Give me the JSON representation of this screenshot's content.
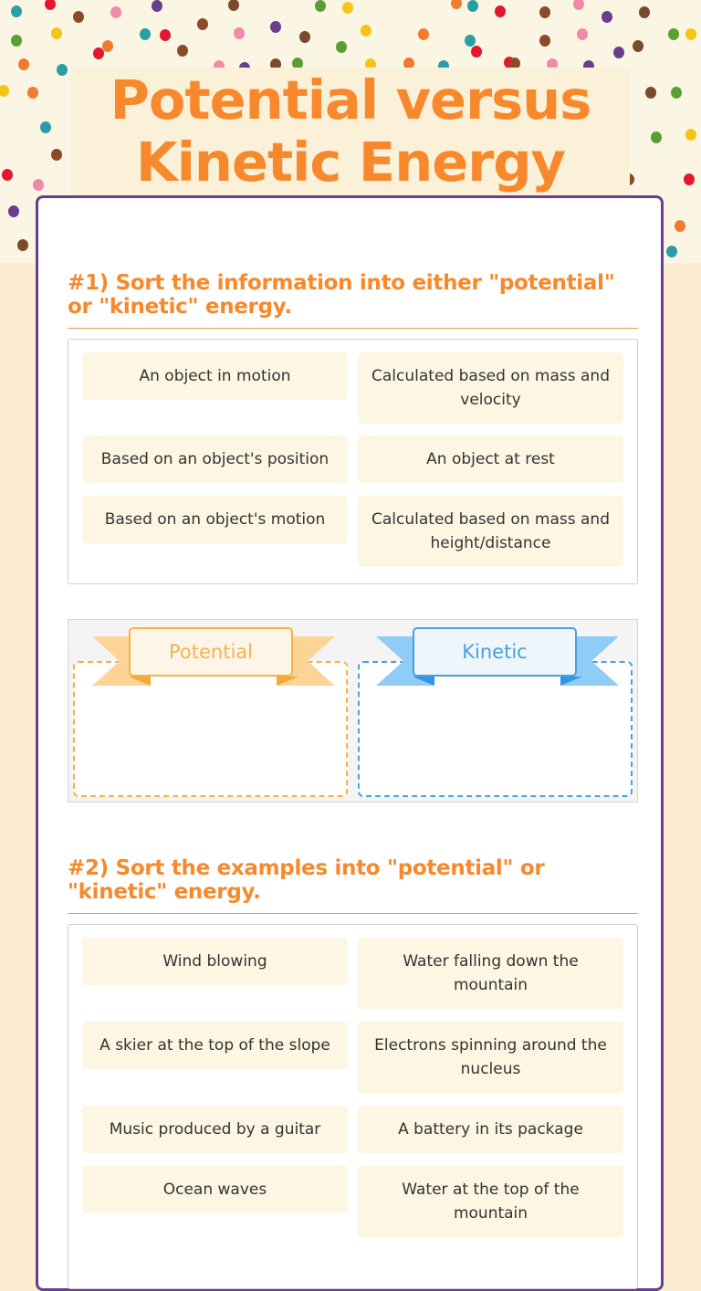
{
  "page": {
    "title_line1": "Potential versus",
    "title_line2": "Kinetic Energy"
  },
  "colors": {
    "accent_orange": "#f7892c",
    "card_border_purple": "#6a3d8f",
    "potential_color": "#f6b13f",
    "kinetic_color": "#4ba0df",
    "tile_bg": "#fdf6e3"
  },
  "section1": {
    "heading": "#1) Sort the information into either \"potential\" or \"kinetic\" energy.",
    "tiles": [
      "An object in motion",
      "Calculated based on mass and velocity",
      "Based on an object's position",
      "An object at rest",
      "Based on an object's motion",
      "Calculated based on mass and height/distance"
    ],
    "categories": [
      {
        "label": "Potential"
      },
      {
        "label": "Kinetic"
      }
    ]
  },
  "section2": {
    "heading": "#2) Sort the examples into \"potential\" or \"kinetic\" energy.",
    "tiles": [
      "Wind blowing",
      "Water falling down the mountain",
      "A skier at the top of the slope",
      "Electrons spinning around the nucleus",
      "Music produced by a guitar",
      "A battery in its package",
      "Ocean waves",
      "Water at the top of the mountain"
    ]
  }
}
